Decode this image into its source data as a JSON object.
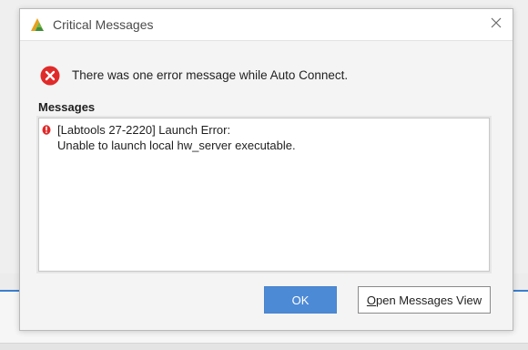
{
  "dialog": {
    "title": "Critical Messages",
    "summary": "There was one error message while Auto Connect.",
    "messages_header": "Messages",
    "messages": [
      {
        "line1": "[Labtools 27-2220] Launch Error:",
        "line2": "Unable to launch local hw_server executable."
      }
    ],
    "buttons": {
      "ok": "OK",
      "open_messages_view": {
        "mnemonic": "O",
        "rest": "pen Messages View"
      }
    }
  },
  "icons": {
    "app": "vivado-logo-icon",
    "close": "close-icon",
    "error": "error-icon",
    "message_bullet": "critical-warning-icon"
  },
  "colors": {
    "primary_button": "#4d8ad6",
    "error_red": "#e02a2a",
    "accent_line": "#3b7fd0"
  }
}
